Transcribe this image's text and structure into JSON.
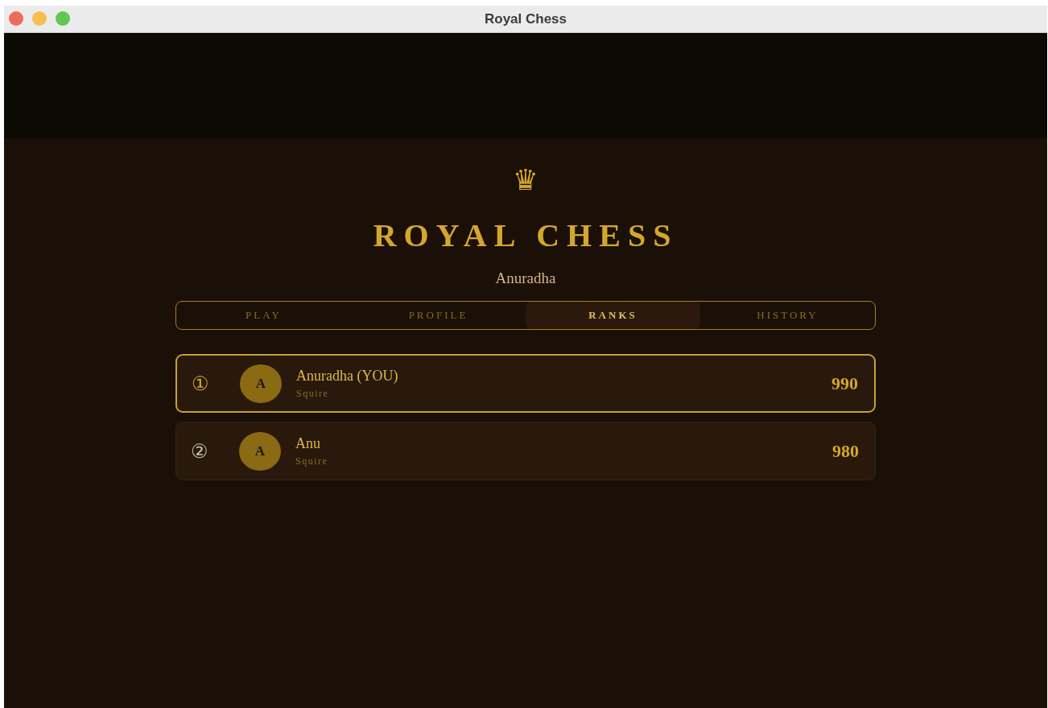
{
  "window": {
    "title": "Royal Chess"
  },
  "header": {
    "logo": "♛",
    "title": "ROYAL CHESS",
    "player": "Anuradha"
  },
  "tabs": [
    {
      "label": "PLAY",
      "selected": false
    },
    {
      "label": "PROFILE",
      "selected": false
    },
    {
      "label": "RANKS",
      "selected": true
    },
    {
      "label": "HISTORY",
      "selected": false
    }
  ],
  "leaderboard": [
    {
      "rank": "①",
      "initial": "A",
      "name": "Anuradha (YOU)",
      "title": "Squire",
      "rating": "990",
      "highlighted": true
    },
    {
      "rank": "②",
      "initial": "A",
      "name": "Anu",
      "title": "Squire",
      "rating": "980",
      "highlighted": false
    }
  ]
}
